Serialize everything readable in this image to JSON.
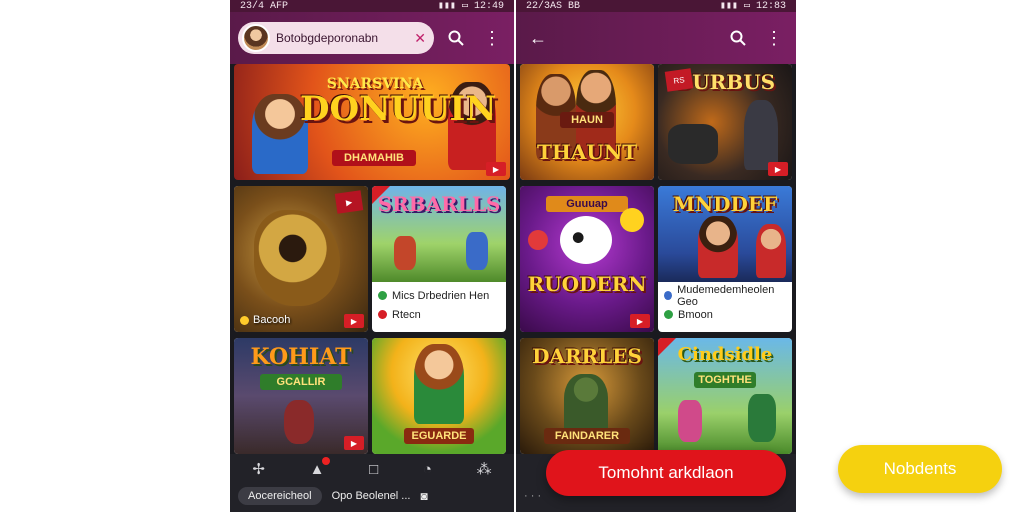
{
  "phoneA": {
    "status": {
      "time": "23/4 AFP",
      "right": "12:49"
    },
    "search_chip": "Botobgdeporonabn",
    "banner": {
      "title": "DONUUIN",
      "sub": "SNARSVINA",
      "strip": "DHAMAHIB"
    },
    "tiles": [
      {
        "title": "",
        "overlay_label": "Bacooh",
        "corner": ""
      },
      {
        "title": "SRBARLLS",
        "line1": "Mics Drbedrien Hen",
        "line2": "Rtecn",
        "corner": ""
      },
      {
        "title": "KOHIAT",
        "sub": "GCALLIR"
      },
      {
        "title": "",
        "strip": "EGUARDE"
      }
    ],
    "nav": {
      "pill": "Aocereicheol",
      "text": "Opo Beolenel ..."
    }
  },
  "phoneB": {
    "status": {
      "time": "22/3AS BB",
      "right": "12:83"
    },
    "tiles": [
      {
        "title": "THAUNT",
        "sub": "HAUN"
      },
      {
        "title": "DURBUS",
        "corner": "RS"
      },
      {
        "title": "RUODERN",
        "sub": "Guuuap"
      },
      {
        "title": "MNDDEF",
        "line1": "Mudemedemheolen Geo",
        "line2": "Bmoon"
      },
      {
        "title": "DARRLES",
        "strip": "FAINDARER"
      },
      {
        "title": "Cindsidle",
        "sub": "TOGHTHE"
      }
    ]
  },
  "cta_red": "Tomohnt arkdlaon",
  "cta_yellow": "Nobdents",
  "icons": [
    "search-icon",
    "more-vert-icon",
    "back-arrow-icon",
    "close-icon",
    "pin-icon",
    "rocket-icon",
    "square-icon",
    "clock-icon",
    "tree-icon",
    "plus-icon"
  ]
}
